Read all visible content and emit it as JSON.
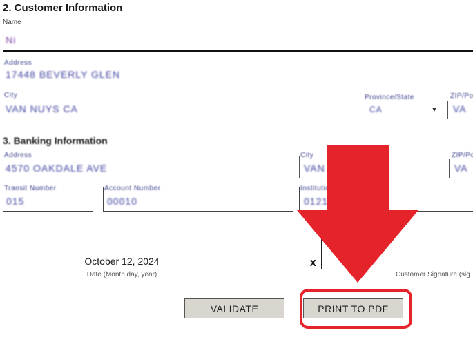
{
  "section2": {
    "title": "2. Customer Information",
    "name_label": "Name",
    "name_value": "Ni",
    "address_label": "Address",
    "address_value": "17448 BEVERLY GLEN",
    "city_label": "City",
    "city_value": "VAN NUYS CA",
    "province_label": "Province/State",
    "province_value": "CA",
    "postal_label": "ZIP/Postal",
    "postal_value": "VA"
  },
  "section3": {
    "title": "3. Banking Information",
    "address_label": "Address",
    "address_value": "4570 OAKDALE AVE",
    "city_label": "City",
    "city_value": "VAN",
    "postal_label": "ZIP/Postal",
    "postal_value": "VA",
    "transit_label": "Transit Number",
    "transit_value": "015",
    "account_label": "Account Number",
    "account_value": "00010",
    "institution_label": "Institution Number",
    "institution_value": "0121"
  },
  "signature": {
    "date_value": "October 12, 2024",
    "date_caption": "Date (Month day, year)",
    "x_mark": "X",
    "signature_caption": "Customer Signature (sig"
  },
  "buttons": {
    "validate_label": "VALIDATE",
    "print_label": "PRINT TO PDF"
  },
  "colors": {
    "arrow": "#e5232b",
    "button_bg": "#d9d6d0"
  }
}
